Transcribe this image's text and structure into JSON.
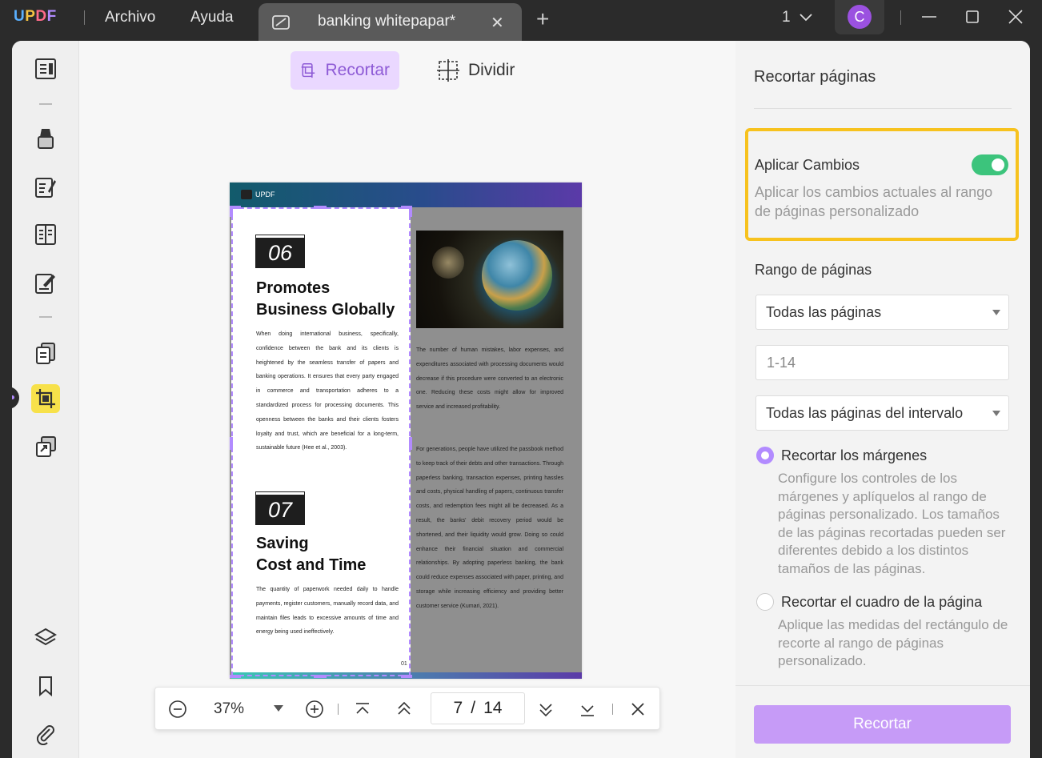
{
  "titlebar": {
    "logo": [
      "U",
      "P",
      "D",
      "F"
    ],
    "menu": [
      "Archivo",
      "Ayuda"
    ],
    "tab_title": "banking whitepapar*",
    "page_indicator": "1",
    "avatar_initial": "C"
  },
  "toolbar": {
    "crop_label": "Recortar",
    "split_label": "Dividir"
  },
  "document": {
    "logo_text": "UPDF",
    "section1_number": "06",
    "section1_title_line1": "Promotes",
    "section1_title_line2": "Business Globally",
    "section1_body": "When doing international business, specifically, confidence between the bank and its clients is heightened by the seamless transfer of papers and banking operations. It ensures that every party engaged in commerce and transportation adheres to a standardized process for processing documents. This openness between the banks and their clients fosters loyalty and trust, which are beneficial for a long-term, sustainable future (Hee et al., 2003).",
    "section2_number": "07",
    "section2_title_line1": "Saving",
    "section2_title_line2": "Cost and Time",
    "section2_body": "The quantity of paperwork needed daily to handle payments, register customers, manually record data, and maintain files leads to excessive amounts of time and energy being used ineffectively.",
    "right_para1": "The number of human mistakes, labor expenses, and expenditures associated with processing documents would decrease if this procedure were converted to an electronic one. Reducing these costs might allow for improved service and increased profitability.",
    "right_para2": "For generations, people have utilized the passbook method to keep track of their debts and other transactions. Through paperless banking, transaction expenses, printing hassles and costs, physical handling of papers, continuous transfer costs, and redemption fees might all be decreased. As a result, the banks' debit recovery period would be shortened, and their liquidity would grow. Doing so could enhance their financial situation and commercial relationships. By adopting paperless banking, the bank could reduce expenses associated with paper, printing, and storage while increasing efficiency and providing better customer service (Kumari, 2021).",
    "page_no": "01"
  },
  "zoombar": {
    "zoom": "37%",
    "current_page": "7",
    "separator": "/",
    "total_pages": "14"
  },
  "panel": {
    "title": "Recortar páginas",
    "apply_title": "Aplicar Cambios",
    "apply_desc": "Aplicar los cambios actuales al rango de páginas personalizado",
    "apply_enabled": true,
    "range_label": "Rango de páginas",
    "range_select": "Todas las páginas",
    "range_input": "1-14",
    "subset_select": "Todas las páginas del intervalo",
    "option1_label": "Recortar los márgenes",
    "option1_desc": "Configure los controles de los márgenes y aplíquelos al rango de páginas personalizado. Los tamaños de las páginas recortadas pueden ser diferentes debido a los distintos tamaños de las páginas.",
    "option2_label": "Recortar el cuadro de la página",
    "option2_desc": "Aplique las medidas del rectángulo de recorte al rango de páginas personalizado.",
    "button_label": "Recortar"
  },
  "colors": {
    "accent": "#b28bff",
    "highlight": "#f7c21e",
    "toggle_on": "#3cc47c"
  }
}
